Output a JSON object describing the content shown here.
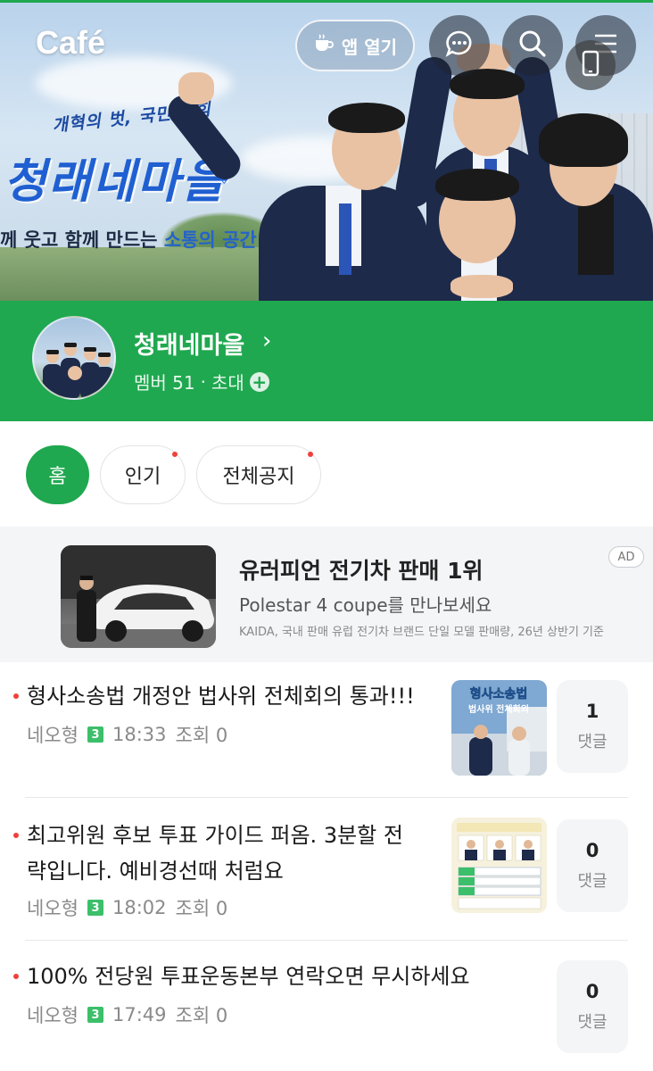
{
  "header": {
    "logo": "Café",
    "app_open_label": "앱 열기",
    "icons": [
      "coffee-cup-icon",
      "chat-bubble-icon",
      "search-icon",
      "menu-icon",
      "phone-icon"
    ]
  },
  "banner": {
    "slogan_small": "개혁의 벗, 국민의 힘",
    "slogan_big": "청래네마을",
    "slogan_line_prefix": "께 웃고 함께 만드는 ",
    "slogan_line_highlight": "소통의 공간"
  },
  "cafe": {
    "name": "청래네마을",
    "members": "멤버 51",
    "separator": "·",
    "invite": "초대"
  },
  "tabs": [
    {
      "label": "홈",
      "active": true,
      "new": false
    },
    {
      "label": "인기",
      "active": false,
      "new": true
    },
    {
      "label": "전체공지",
      "active": false,
      "new": true
    }
  ],
  "ad": {
    "title": "유러피언 전기차 판매 1위",
    "subtitle": "Polestar 4 coupe를 만나보세요",
    "note": "KAIDA, 국내 판매 유럽 전기차 브랜드 단일 모델 판매량, 26년 상반기 기준",
    "badge": "AD"
  },
  "posts": [
    {
      "title_lines": [
        "형사소송법 개정안 법사위 전체회의 통과!!!"
      ],
      "author": "네오형",
      "level": "3",
      "time": "18:33",
      "views": "조회 0",
      "comments": "1",
      "comment_label": "댓글",
      "thumb_caption_1": "형사소송법",
      "thumb_caption_2": "법사위 전체회의"
    },
    {
      "title_lines": [
        "최고위원 후보 투표 가이드 퍼옴. 3분할 전",
        "략입니다. 예비경선때 처럼요"
      ],
      "author": "네오형",
      "level": "3",
      "time": "18:02",
      "views": "조회 0",
      "comments": "0",
      "comment_label": "댓글"
    },
    {
      "title_lines": [
        "100% 전당원 투표운동본부 연락오면 무시하세요"
      ],
      "author": "네오형",
      "level": "3",
      "time": "17:49",
      "views": "조회 0",
      "comments": "0",
      "comment_label": "댓글"
    }
  ],
  "colors": {
    "brand_green": "#1fa84f",
    "new_dot": "#f0403c",
    "level_badge": "#3cbf6a"
  }
}
